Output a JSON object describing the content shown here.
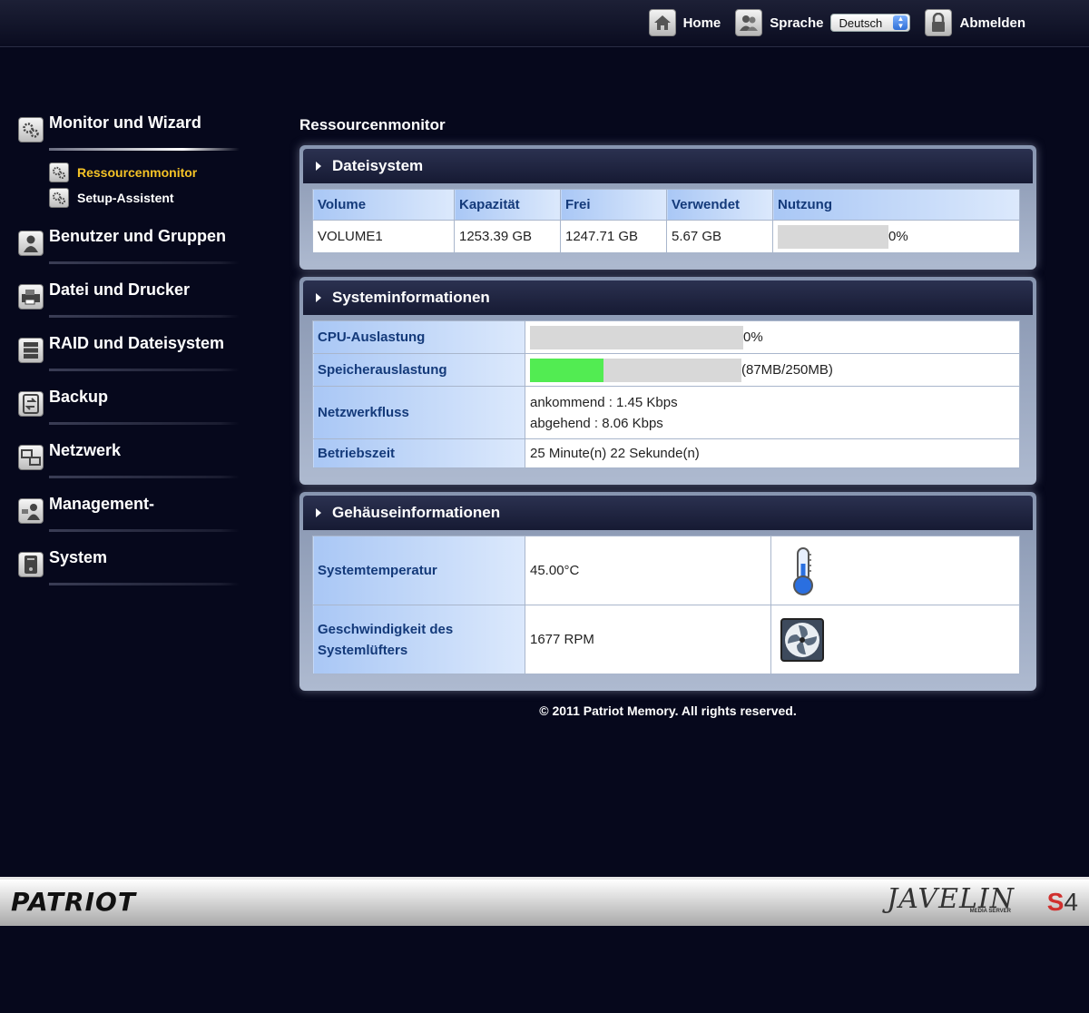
{
  "topnav": {
    "home_label": "Home",
    "language_label": "Sprache",
    "language_value": "Deutsch",
    "logout_label": "Abmelden"
  },
  "sidebar": {
    "sections": [
      {
        "label": "Monitor und Wizard",
        "icon": "gears-icon",
        "active": true,
        "items": [
          {
            "label": "Ressourcenmonitor",
            "active": true
          },
          {
            "label": "Setup-Assistent",
            "active": false
          }
        ]
      },
      {
        "label": "Benutzer und Gruppen",
        "icon": "user-icon"
      },
      {
        "label": "Datei und Drucker",
        "icon": "printer-icon"
      },
      {
        "label": "RAID und Dateisystem",
        "icon": "drives-icon"
      },
      {
        "label": "Backup",
        "icon": "backup-icon"
      },
      {
        "label": "Netzwerk",
        "icon": "network-icon"
      },
      {
        "label": "Management-",
        "icon": "management-icon"
      },
      {
        "label": "System",
        "icon": "system-icon"
      }
    ]
  },
  "main": {
    "title": "Ressourcenmonitor",
    "filesystem": {
      "title": "Dateisystem",
      "columns": [
        "Volume",
        "Kapazität",
        "Frei",
        "Verwendet",
        "Nutzung"
      ],
      "row": {
        "volume": "VOLUME1",
        "capacity": "1253.39 GB",
        "free": "1247.71 GB",
        "used": "5.67 GB",
        "usage_text": "0%",
        "usage_fraction": 0.0
      }
    },
    "sysinfo": {
      "title": "Systeminformationen",
      "cpu_label": "CPU-Auslastung",
      "cpu_text": "0%",
      "cpu_fraction": 0.0,
      "mem_label": "Speicherauslastung",
      "mem_text": "(87MB/250MB)",
      "mem_fraction": 0.348,
      "net_label": "Netzwerkfluss",
      "net_in": "ankommend : 1.45 Kbps",
      "net_out": "abgehend : 8.06 Kbps",
      "uptime_label": "Betriebszeit",
      "uptime_value": "25 Minute(n) 22 Sekunde(n)"
    },
    "chassis": {
      "title": "Gehäuseinformationen",
      "temp_label": "Systemtemperatur",
      "temp_value": "45.00°C",
      "fan_label_1": "Geschwindigkeit des",
      "fan_label_2": "Systemlüfters",
      "fan_value": "1677 RPM"
    },
    "copyright": "© 2011 Patriot Memory. All rights reserved."
  },
  "brand": {
    "left_logo": "PATRIOT",
    "right_logo": "JAVELIN",
    "right_sub": "MEDIA SERVER",
    "model_s": "S",
    "model_n": "4"
  },
  "colors": {
    "accent_active": "#f5c326",
    "memory_fill": "#52ec52",
    "header_text": "#143a7a"
  }
}
